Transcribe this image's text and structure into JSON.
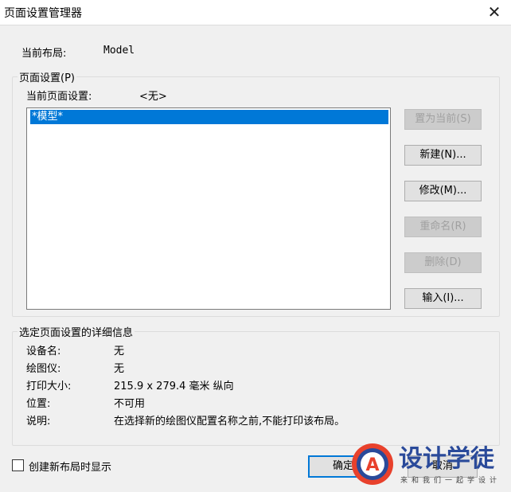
{
  "window": {
    "title": "页面设置管理器",
    "close_glyph": "✕"
  },
  "current_layout": {
    "label": "当前布局:",
    "value": "Model"
  },
  "page_setups": {
    "legend": "页面设置(P)",
    "current_label": "当前页面设置:",
    "current_value": "<无>",
    "items": [
      "*模型*"
    ],
    "buttons": {
      "set_current": "置为当前(S)",
      "new": "新建(N)...",
      "modify": "修改(M)...",
      "rename": "重命名(R)",
      "delete": "删除(D)",
      "import": "输入(I)..."
    }
  },
  "details": {
    "legend": "选定页面设置的详细信息",
    "rows": [
      {
        "label": "设备名:",
        "value": "无"
      },
      {
        "label": "绘图仪:",
        "value": "无"
      },
      {
        "label": "打印大小:",
        "value": "215.9 x 279.4 毫米 纵向"
      },
      {
        "label": "位置:",
        "value": "不可用"
      },
      {
        "label": "说明:",
        "value": "在选择新的绘图仪配置名称之前,不能打印该布局。"
      }
    ]
  },
  "footer": {
    "checkbox_label": "创建新布局时显示",
    "ok_label": "确定",
    "cancel_label": "取消"
  },
  "watermark": {
    "brand": "设计学徒",
    "tagline": "来和我们一起学设计",
    "logo_letter": "A"
  },
  "colors": {
    "selection": "#0078d7",
    "brand_red": "#e8412c",
    "brand_blue": "#2a4a9a"
  }
}
